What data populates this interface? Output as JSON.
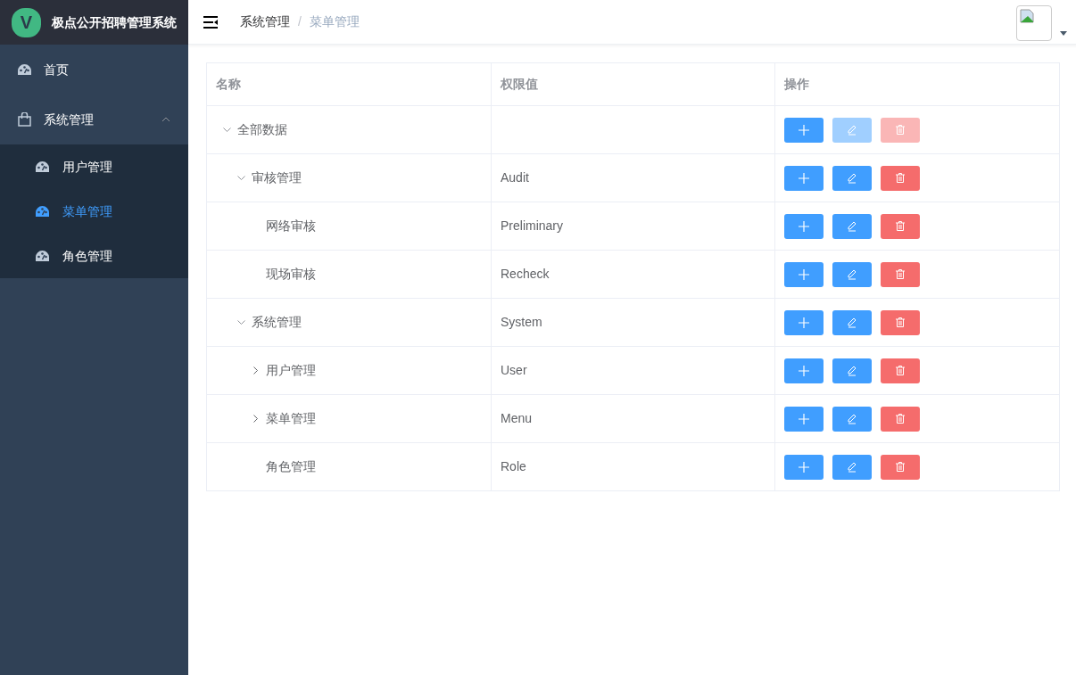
{
  "app": {
    "logo_letter": "V",
    "title": "极点公开招聘管理系统"
  },
  "sidebar": {
    "items": [
      {
        "label": "首页",
        "kind": "link",
        "selected": false
      },
      {
        "label": "系统管理",
        "kind": "group",
        "selected": false,
        "expanded": true,
        "children": [
          {
            "label": "用户管理",
            "kind": "link",
            "selected": false
          },
          {
            "label": "菜单管理",
            "kind": "link",
            "selected": true
          },
          {
            "label": "角色管理",
            "kind": "link",
            "selected": false
          }
        ]
      }
    ]
  },
  "breadcrumb": [
    "系统管理",
    "菜单管理"
  ],
  "breadcrumb_separator": "/",
  "table": {
    "columns": [
      "名称",
      "权限值",
      "操作"
    ],
    "rows": [
      {
        "name": "全部数据",
        "expanded": true,
        "actions_disabled": true,
        "children": [
          {
            "name": "审核管理",
            "value": "Audit",
            "expanded": true,
            "actions_disabled": false,
            "children": [
              {
                "name": "网络审核",
                "value": "Preliminary",
                "actions_disabled": false
              },
              {
                "name": "现场审核",
                "value": "Recheck",
                "actions_disabled": false
              }
            ]
          },
          {
            "name": "系统管理",
            "value": "System",
            "expanded": true,
            "actions_disabled": false,
            "children": [
              {
                "name": "用户管理",
                "value": "User",
                "expanded": false,
                "actions_disabled": false
              },
              {
                "name": "菜单管理",
                "value": "Menu",
                "expanded": false,
                "actions_disabled": false
              },
              {
                "name": "角色管理",
                "value": "Role",
                "actions_disabled": false
              }
            ]
          }
        ]
      }
    ]
  }
}
